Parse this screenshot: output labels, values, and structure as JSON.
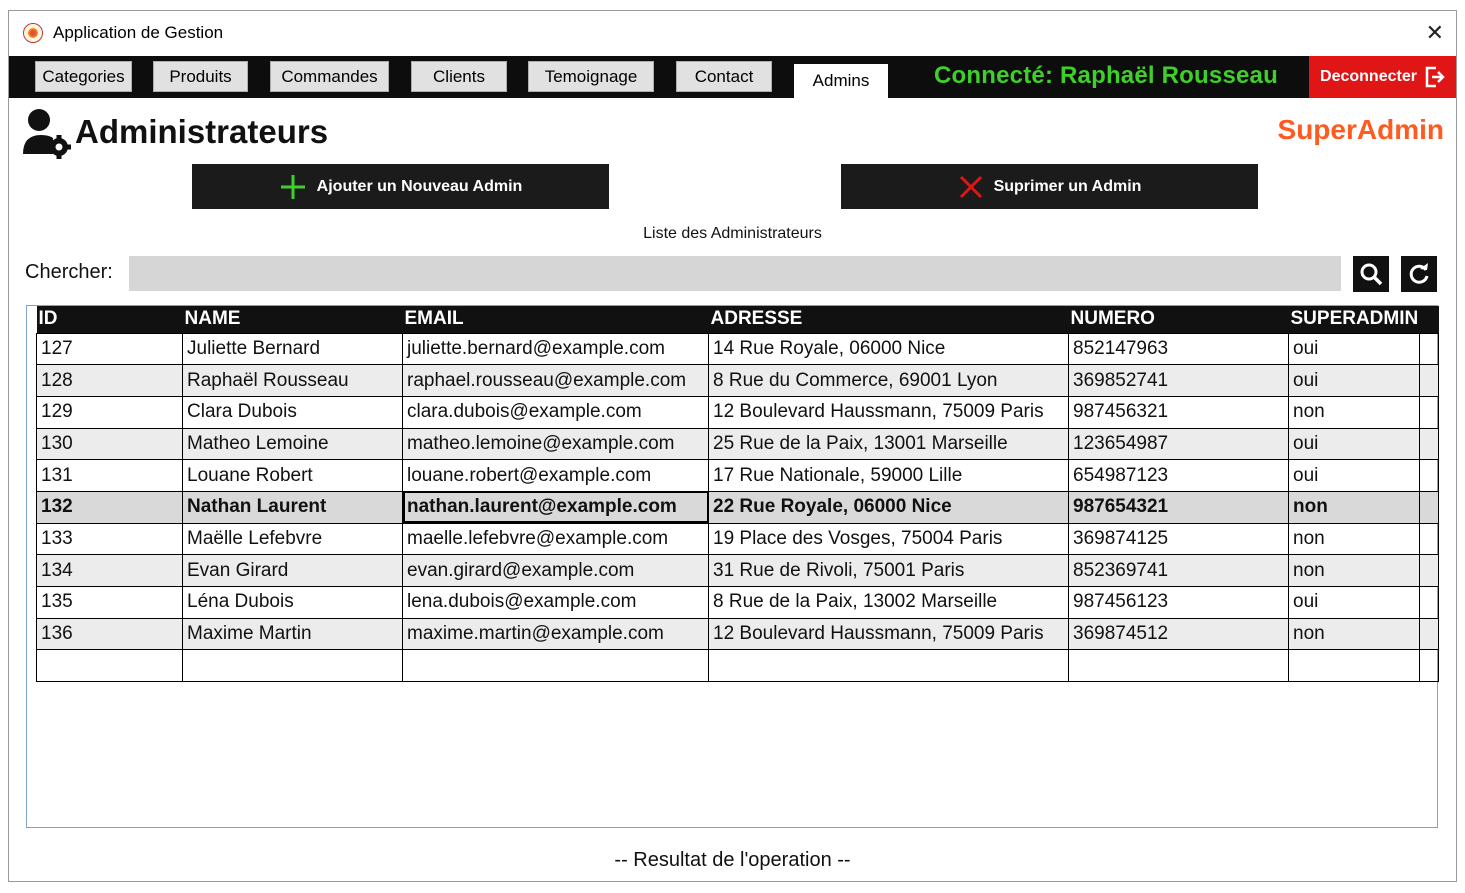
{
  "window": {
    "title": "Application de Gestion",
    "close_label": "✕"
  },
  "nav": {
    "tabs": [
      {
        "label": "Categories",
        "active": false
      },
      {
        "label": "Produits",
        "active": false
      },
      {
        "label": "Commandes",
        "active": false
      },
      {
        "label": "Clients",
        "active": false
      },
      {
        "label": "Temoignage",
        "active": false
      },
      {
        "label": "Contact",
        "active": false
      },
      {
        "label": "Admins",
        "active": true
      }
    ],
    "connected_text": "Connecté: Raphaël Rousseau",
    "logout_label": "Deconnecter"
  },
  "header": {
    "title": "Administrateurs",
    "icon": "user-gear-icon",
    "role": "SuperAdmin"
  },
  "actions": {
    "add_label": "Ajouter un Nouveau Admin",
    "delete_label": "Suprimer un Admin"
  },
  "list": {
    "title": "Liste des Administrateurs",
    "search_label": "Chercher:",
    "search_value": "",
    "columns": [
      "ID",
      "NAME",
      "EMAIL",
      "ADRESSE",
      "NUMERO",
      "SUPERADMIN"
    ],
    "rows": [
      [
        "127",
        "Juliette Bernard",
        "juliette.bernard@example.com",
        "14 Rue Royale, 06000 Nice",
        "852147963",
        "oui"
      ],
      [
        "128",
        "Raphaël Rousseau",
        "raphael.rousseau@example.com",
        "8 Rue du Commerce, 69001 Lyon",
        "369852741",
        "oui"
      ],
      [
        "129",
        "Clara Dubois",
        "clara.dubois@example.com",
        "12 Boulevard Haussmann, 75009 Paris",
        "987456321",
        "non"
      ],
      [
        "130",
        "Matheo Lemoine",
        "matheo.lemoine@example.com",
        "25 Rue de la Paix, 13001 Marseille",
        "123654987",
        "oui"
      ],
      [
        "131",
        "Louane Robert",
        "louane.robert@example.com",
        "17 Rue Nationale, 59000 Lille",
        "654987123",
        "oui"
      ],
      [
        "132",
        "Nathan Laurent",
        "nathan.laurent@example.com",
        "22 Rue Royale, 06000 Nice",
        "987654321",
        "non"
      ],
      [
        "133",
        "Maëlle Lefebvre",
        "maelle.lefebvre@example.com",
        "19 Place des Vosges, 75004 Paris",
        "369874125",
        "non"
      ],
      [
        "134",
        "Evan Girard",
        "evan.girard@example.com",
        "31 Rue de Rivoli, 75001 Paris",
        "852369741",
        "non"
      ],
      [
        "135",
        "Léna Dubois",
        "lena.dubois@example.com",
        "8 Rue de la Paix, 13002 Marseille",
        "987456123",
        "oui"
      ],
      [
        "136",
        "Maxime Martin",
        "maxime.martin@example.com",
        "12 Boulevard Haussmann, 75009 Paris",
        "369874512",
        "non"
      ]
    ],
    "selected_row_index": 5
  },
  "status": {
    "text": "-- Resultat de l'operation --"
  },
  "colors": {
    "accent_green": "#3fcf2a",
    "danger_red": "#e01515",
    "role_orange": "#ff5a1f"
  }
}
